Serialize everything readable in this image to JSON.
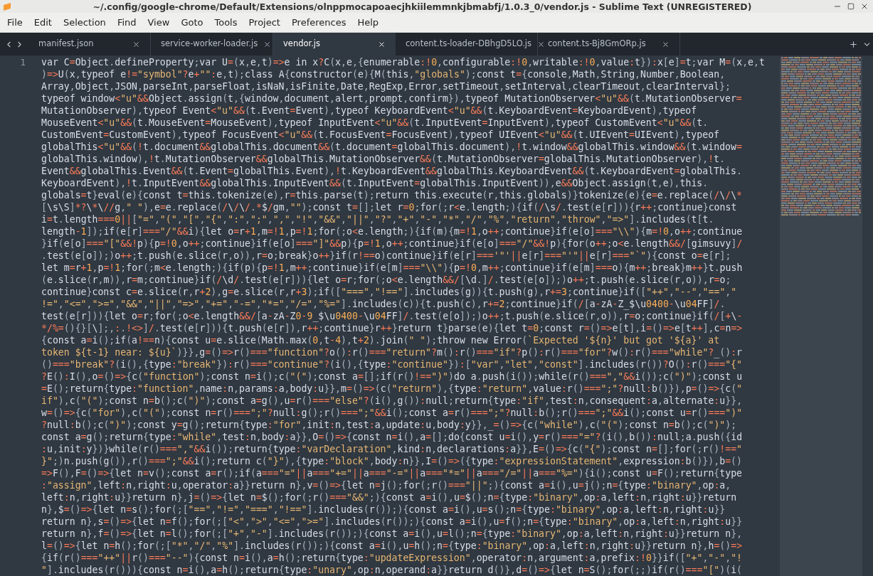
{
  "window": {
    "title": "~/.config/google-chrome/Default/Extensions/olnppmocapoaecjhkiilemmnkjbmabfj/1.0.3_0/vendor.js - Sublime Text (UNREGISTERED)"
  },
  "menu": [
    "File",
    "Edit",
    "Selection",
    "Find",
    "View",
    "Goto",
    "Tools",
    "Project",
    "Preferences",
    "Help"
  ],
  "tabs": [
    {
      "label": "manifest.json",
      "selected": false
    },
    {
      "label": "service-worker-loader.js",
      "selected": false
    },
    {
      "label": "vendor.js",
      "selected": true
    },
    {
      "label": "content.ts-loader-DBhgD5LO.js",
      "selected": false
    },
    {
      "label": "content.ts-Bj8GmORp.js",
      "selected": false
    }
  ],
  "editor": {
    "line_numbers": [
      "1"
    ],
    "code_lines": [
      "var C=Object.defineProperty;var U=(x,e,t)=>e in x?C(x,e,{enumerable:!0,configurable:!0,writable:!0,value:t}):x[e]=t;var M=(x,e,t",
      ")=>U(x,typeof e!=\"symbol\"?e+\"\":e,t);class A{constructor(e){M(this,\"globals\");const t={console,Math,String,Number,Boolean,",
      "Array,Object,JSON,parseInt,parseFloat,isNaN,isFinite,Date,RegExp,Error,setTimeout,setInterval,clearTimeout,clearInterval};",
      "typeof window<\"u\"&&Object.assign(t,{window,document,alert,prompt,confirm}),typeof MutationObserver<\"u\"&&(t.MutationObserver=",
      "MutationObserver),typeof Event<\"u\"&&(t.Event=Event),typeof KeyboardEvent<\"u\"&&(t.KeyboardEvent=KeyboardEvent),typeof",
      "MouseEvent<\"u\"&&(t.MouseEvent=MouseEvent),typeof InputEvent<\"u\"&&(t.InputEvent=InputEvent),typeof CustomEvent<\"u\"&&(t.",
      "CustomEvent=CustomEvent),typeof FocusEvent<\"u\"&&(t.FocusEvent=FocusEvent),typeof UIEvent<\"u\"&&(t.UIEvent=UIEvent),typeof",
      "globalThis<\"u\"&&(!t.document&&globalThis.document&&(t.document=globalThis.document),!t.window&&globalThis.window&&(t.window=",
      "globalThis.window),!t.MutationObserver&&globalThis.MutationObserver&&(t.MutationObserver=globalThis.MutationObserver),!t.",
      "Event&&globalThis.Event&&(t.Event=globalThis.Event),!t.KeyboardEvent&&globalThis.KeyboardEvent&&(t.KeyboardEvent=globalThis.",
      "KeyboardEvent),!t.InputEvent&&globalThis.InputEvent&&(t.InputEvent=globalThis.InputEvent)),e&&Object.assign(t,e),this.",
      "globals=t}eval(e){const t=this.tokenize(e),r=this.parse(t);return this.execute(r,this.globals)}tokenize(e){e=e.replace(/\\/\\*",
      "[\\s\\S]*?\\*\\//g,\" \"),e=e.replace(/\\/\\/.*$/gm,\"\");const t=[];let r=0;for(;r<e.length;){if(/\\s/.test(e[r])){r++;continue}const",
      "i=t.length===0||[\"=\",\"(\",\"[\",\"{\",\":\",\";\",\",\",\"!\",\"&&\",\"||\",\"?\",\"+\",\"-\",\"*\",\"/\",\"%\",\"return\",\"throw\",\"=>\"].includes(t[t.",
      "length-1]);if(e[r]===\"/\"&&i){let o=r+1,m=!1,p=!1;for(;o<e.length;){if(m){m=!1,o++;continue}if(e[o]===\"\\\\\"){m=!0,o++;continue",
      "}if(e[o]===\"[\"&&!p){p=!0,o++;continue}if(e[o]===\"]\"&&p){p=!1,o++;continue}if(e[o]===\"/\"&&!p){for(o++;o<e.length&&/[gimsuvy]/",
      ".test(e[o]);)o++;t.push(e.slice(r,o)),r=o;break}o++}if(r!==o)continue}if(e[r]==='\"'||e[r]===\"'\"||e[r]===\"`\"){const o=e[r];",
      "let m=r+1,p=!1;for(;m<e.length;){if(p){p=!1,m++;continue}if(e[m]===\"\\\\\"){p=!0,m++;continue}if(e[m]===o){m++;break}m++}t.push",
      "(e.slice(r,m)),r=m;continue}if(/\\d/.test(e[r])){let o=r;for(;o<e.length&&/[\\d.]/.test(e[o]);)o++;t.push(e.slice(r,o)),r=o;",
      "continue}const c=e.slice(r,r+2),g=e.slice(r,r+3);if([\"===\",\"!==\"].includes(g)){t.push(g),r+=3;continue}if([\"++\",\"--\",\"==\",\"",
      "!=\",\"<=\",\">=\",\"&&\",\"||\",\"=>\",\"+=\",\"-=\",\"*=\",\"/=\",\"%=\"].includes(c)){t.push(c),r+=2;continue}if(/[a-zA-Z_$\\u0400-\\u04FF]/.",
      "test(e[r])){let o=r;for(;o<e.length&&/[a-zA-Z0-9_$\\u0400-\\u04FF]/.test(e[o]);)o++;t.push(e.slice(r,o)),r=o;continue}if(/[+\\-",
      "*/%=(){}[\\];,:.!<>]/.test(e[r])){t.push(e[r]),r++;continue}r++}return t}parse(e){let t=0;const r=()=>e[t],i=()=>e[t++],c=n=>",
      "{const a=i();if(a!==n){const u=e.slice(Math.max(0,t-4),t+2).join(\" \");throw new Error(`Expected '${n}' but got '${a}' at",
      "token ${t-1} near: ${u}`)}},g=()=>r()===\"function\"?o():r()===\"return\"?m():r()===\"if\"?p():r()===\"for\"?w():r()===\"while\"?_():r",
      "()===\"break\"?(i(),{type:\"break\"}):r()===\"continue\"?(i(),{type:\"continue\"}):[\"var\",\"let\",\"const\"].includes(r())?O():r()===\"{\"",
      "?E():I(),o=()=>{c(\"function\");const n=i();c(\"(\");const a=[];if(r()!==\")\")do a.push(i());while(r()===\",\"&&i());c(\")\");const u",
      "=E();return{type:\"function\",name:n,params:a,body:u}},m=()=>(c(\"return\"),{type:\"return\",value:r()===\";\"?null:b()}),p=()=>{c(\"",
      "if\"),c(\"(\");const n=b();c(\")\");const a=g(),u=r()===\"else\"?(i(),g()):null;return{type:\"if\",test:n,consequent:a,alternate:u}},",
      "w=()=>{c(\"for\"),c(\"(\");const n=r()===\";\"?null:g();r()===\";\"&&i();const a=r()===\";\"?null:b();r()===\";\"&&i();const u=r()===\")\"",
      "?null:b();c(\")\");const y=g();return{type:\"for\",init:n,test:a,update:u,body:y}},_=()=>{c(\"while\"),c(\"(\");const n=b();c(\")\");",
      "const a=g();return{type:\"while\",test:n,body:a}},O=()=>{const n=i(),a=[];do{const u=i(),y=r()===\"=\"?(i(),b()):null;a.push({id",
      ":u,init:y})}while(r()===\",\"&&i());return{type:\"varDeclaration\",kind:n,declarations:a}},E=()=>{c(\"{\");const n=[];for(;r()!==\"",
      "}\";)n.push(g()),r()===\";\"&&i();return c(\"}\"),{type:\"block\",body:n}},I=()=>({type:\"expressionStatement\",expression:b()}),b=()",
      "=>F(),F=()=>{let n=v();const a=r();if(a===\"=\"||a===\"+=\"||a===\"-=\"||a===\"*=\"||a===\"/=\"||a===\"%=\"){i();const u=F();return{type",
      ":\"assign\",left:n,right:u,operator:a}}return n},v=()=>{let n=j();for(;r()===\"||\";){const a=i(),u=j();n={type:\"binary\",op:a,",
      "left:n,right:u}}return n},j=()=>{let n=$();for(;r()===\"&&\";){const a=i(),u=$();n={type:\"binary\",op:a,left:n,right:u}}return",
      "n},$=()=>{let n=s();for(;[\"==\",\"!=\",\"===\",\"!==\"].includes(r());){const a=i(),u=s();n={type:\"binary\",op:a,left:n,right:u}}",
      "return n},s=()=>{let n=f();for(;[\"<\",\">\",\"<=\",\">=\"].includes(r());){const a=i(),u=f();n={type:\"binary\",op:a,left:n,right:u}}",
      "return n},f=()=>{let n=l();for(;[\"+\",\"-\"].includes(r());){const a=i(),u=l();n={type:\"binary\",op:a,left:n,right:u}}return n},",
      "l=()=>{let n=h();for(;[\"*\",\"/\",\"%\"].includes(r());){const a=i(),u=h();n={type:\"binary\",op:a,left:n,right:u}}return n},h=()=>",
      "{if(r()===\"++\"||r()===\"--\"){const n=i(),a=h();return{type:\"updateExpression\",operator:n,argument:a,prefix:!0}}if([\"+\",\"-\",\"!",
      "\"].includes(r())){const n=i(),a=h();return{type:\"unary\",op:n,operand:a}}return d()},d=()=>{let n=S();for(;;)if(r()===\"[\")(i("
    ]
  }
}
